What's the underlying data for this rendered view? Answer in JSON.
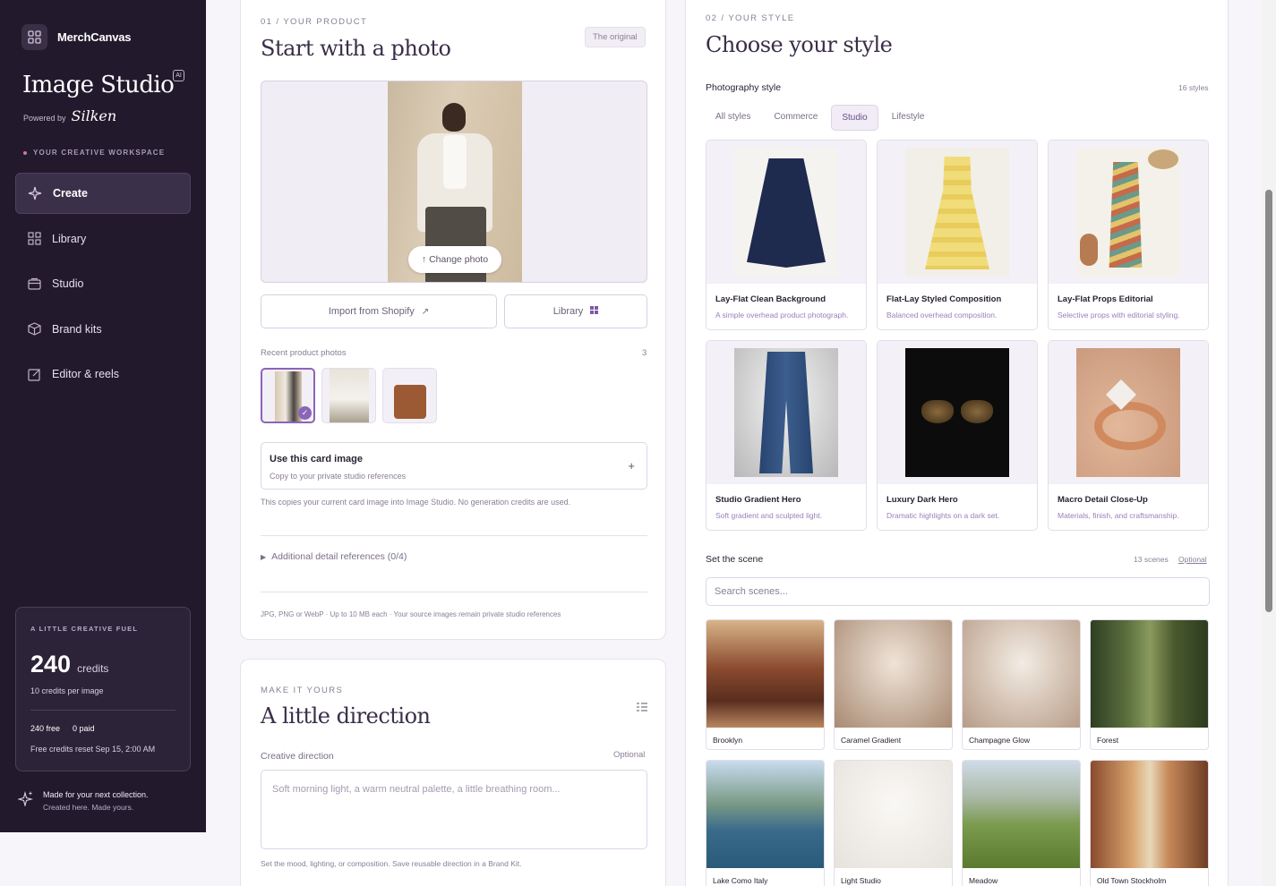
{
  "brand": {
    "name": "MerchCanvas"
  },
  "sidebar": {
    "title": "Image Studio",
    "ai_badge": "AI",
    "powered_by": "Powered by",
    "powered_brand": "Silken",
    "workspace_label": "YOUR CREATIVE WORKSPACE",
    "nav": [
      {
        "label": "Create",
        "icon": "sparkle-icon",
        "active": true
      },
      {
        "label": "Library",
        "icon": "grid-icon"
      },
      {
        "label": "Studio",
        "icon": "folder-icon"
      },
      {
        "label": "Brand kits",
        "icon": "box-icon"
      },
      {
        "label": "Editor & reels",
        "icon": "edit-icon"
      }
    ],
    "credits": {
      "eyebrow": "A LITTLE CREATIVE FUEL",
      "amount": "240",
      "unit": "credits",
      "per_image": "10 credits per image",
      "free": "240 free",
      "paid": "0 paid",
      "reset": "Free credits reset Sep 15, 2:00 AM"
    },
    "footer": {
      "line1": "Made for your next collection.",
      "line2": "Created here. Made yours."
    }
  },
  "product": {
    "eyebrow": "01 / YOUR PRODUCT",
    "title": "Start with a photo",
    "badge": "The original",
    "change_photo": "↑ Change photo",
    "import_shopify": "Import from Shopify",
    "library": "Library",
    "recent_label": "Recent product photos",
    "recent_count": "3",
    "use_title": "Use this card image",
    "use_sub": "Copy to your private studio references",
    "use_note": "This copies your current card image into Image Studio. No generation credits are used.",
    "additional": "Additional detail references (0/4)",
    "formats": "JPG, PNG or WebP · Up to 10 MB each · Your source images remain private studio references"
  },
  "direction": {
    "eyebrow": "MAKE IT YOURS",
    "title": "A little direction",
    "label": "Creative direction",
    "optional": "Optional",
    "placeholder": "Soft morning light, a warm neutral palette, a little breathing room...",
    "help": "Set the mood, lighting, or composition. Save reusable direction in a Brand Kit."
  },
  "style": {
    "eyebrow": "02 / YOUR STYLE",
    "title": "Choose your style",
    "section_label": "Photography style",
    "count": "16 styles",
    "tabs": [
      "All styles",
      "Commerce",
      "Studio",
      "Lifestyle"
    ],
    "active_tab": "Studio",
    "cards": [
      {
        "name": "Lay-Flat Clean Background",
        "desc": "A simple overhead product photograph."
      },
      {
        "name": "Flat-Lay Styled Composition",
        "desc": "Balanced overhead composition."
      },
      {
        "name": "Lay-Flat Props Editorial",
        "desc": "Selective props with editorial styling."
      },
      {
        "name": "Studio Gradient Hero",
        "desc": "Soft gradient and sculpted light."
      },
      {
        "name": "Luxury Dark Hero",
        "desc": "Dramatic highlights on a dark set."
      },
      {
        "name": "Macro Detail Close-Up",
        "desc": "Materials, finish, and craftsmanship."
      }
    ]
  },
  "scene": {
    "label": "Set the scene",
    "count": "13 scenes",
    "optional": "Optional",
    "search_placeholder": "Search scenes...",
    "items": [
      {
        "name": "Brooklyn"
      },
      {
        "name": "Caramel Gradient"
      },
      {
        "name": "Champagne Glow"
      },
      {
        "name": "Forest"
      },
      {
        "name": "Lake Como Italy"
      },
      {
        "name": "Light Studio"
      },
      {
        "name": "Meadow"
      },
      {
        "name": "Old Town Stockholm"
      }
    ]
  }
}
